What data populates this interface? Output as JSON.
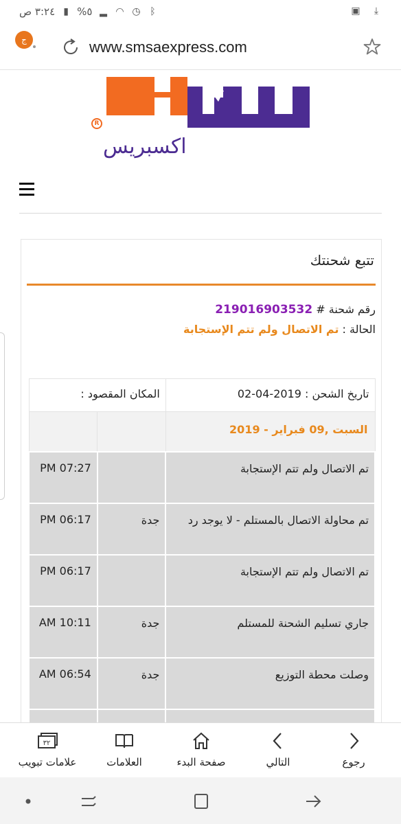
{
  "status_bar": {
    "time": "٣:٢٤ ص",
    "battery": "%٥",
    "icons": [
      "battery-icon",
      "signal-icon",
      "wifi-icon",
      "alarm-icon",
      "bluetooth-icon",
      "screenshot-icon",
      "download-icon"
    ]
  },
  "url_bar": {
    "extension_badge": "ج",
    "url": "www.smsaexpress.com"
  },
  "logo": {
    "subtitle": "اكسبريس",
    "brand_colors": {
      "orange": "#f26b21",
      "purple": "#4c2c92"
    }
  },
  "panel": {
    "title": "تتبع شحنتك",
    "awb_label": "رقم شحنة # ",
    "awb_number": "219016903532",
    "status_label": "الحالة : ",
    "status_value": "تم الاتصال ولم تتم الإستجابة"
  },
  "table": {
    "ship_date": "تاريخ الشحن : 2019-04-02",
    "destination": "المكان المقصود :",
    "date_header": "السبت ,09 فبراير - 2019",
    "events": [
      {
        "desc": "تم الاتصال ولم تتم الإستجابة",
        "location": "",
        "time": "07:27 PM"
      },
      {
        "desc": "تم محاولة الاتصال بالمستلم - لا يوجد رد",
        "location": "جدة",
        "time": "06:17 PM"
      },
      {
        "desc": "تم الاتصال ولم تتم الإستجابة",
        "location": "",
        "time": "06:17 PM"
      },
      {
        "desc": "جاري تسليم الشحنة للمستلم",
        "location": "جدة",
        "time": "10:11 AM"
      },
      {
        "desc": "وصلت محطة التوزيع",
        "location": "جدة",
        "time": "06:54 AM"
      }
    ]
  },
  "toolbar": {
    "back": "رجوع",
    "forward": "التالي",
    "home": "صفحة البدء",
    "bookmarks": "العلامات",
    "tabs": "علامات تبويب",
    "tabs_count": "٣٢"
  },
  "colors": {
    "accent_orange": "#e8891d",
    "awb_purple": "#8a1fb3"
  }
}
